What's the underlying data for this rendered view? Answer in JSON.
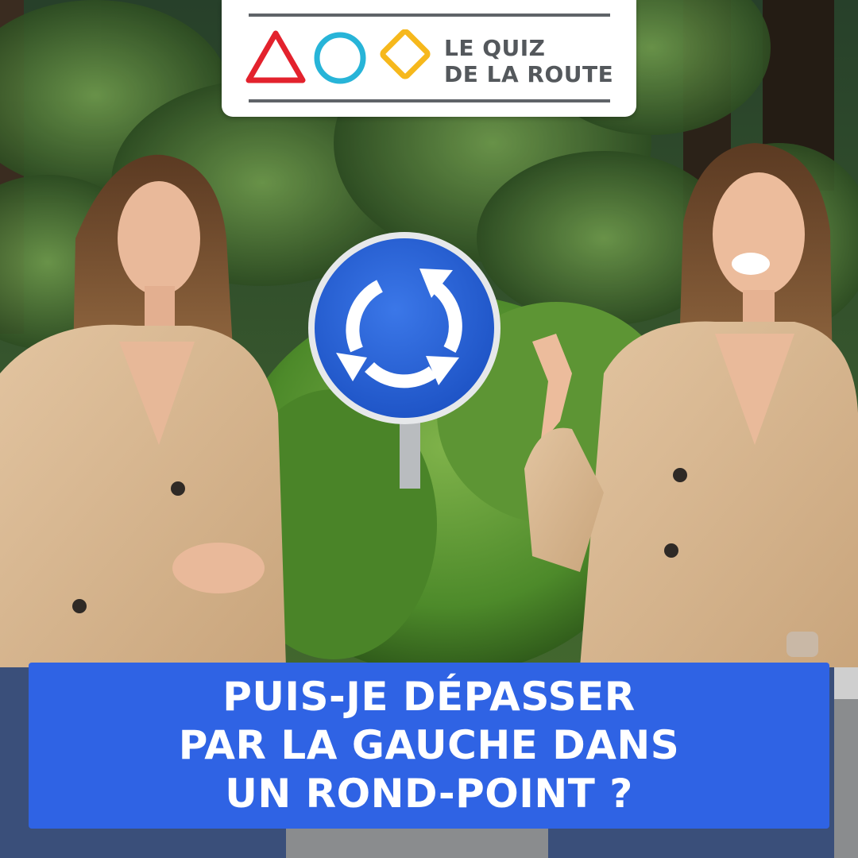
{
  "logo": {
    "line1": "LE QUIZ",
    "line2": "DE LA ROUTE",
    "shapes": [
      "red-triangle-icon",
      "blue-circle-icon",
      "yellow-diamond-icon"
    ],
    "colors": {
      "triangle": "#e3222d",
      "circle": "#27b4d8",
      "diamond": "#f6b81c",
      "text": "#54585c"
    }
  },
  "question": {
    "lines": [
      "PUIS-JE DÉPASSER",
      "PAR LA GAUCHE DANS",
      "UN ROND-POINT ?"
    ],
    "background": "#2f63e4",
    "color": "#ffffff"
  },
  "sign": {
    "icon": "roundabout-sign-icon",
    "color": "#2a62d8"
  },
  "background": {
    "colors": {
      "foliage": "#3f6b30",
      "jacket": "#d8b892",
      "road": "#8a8c8e"
    }
  }
}
